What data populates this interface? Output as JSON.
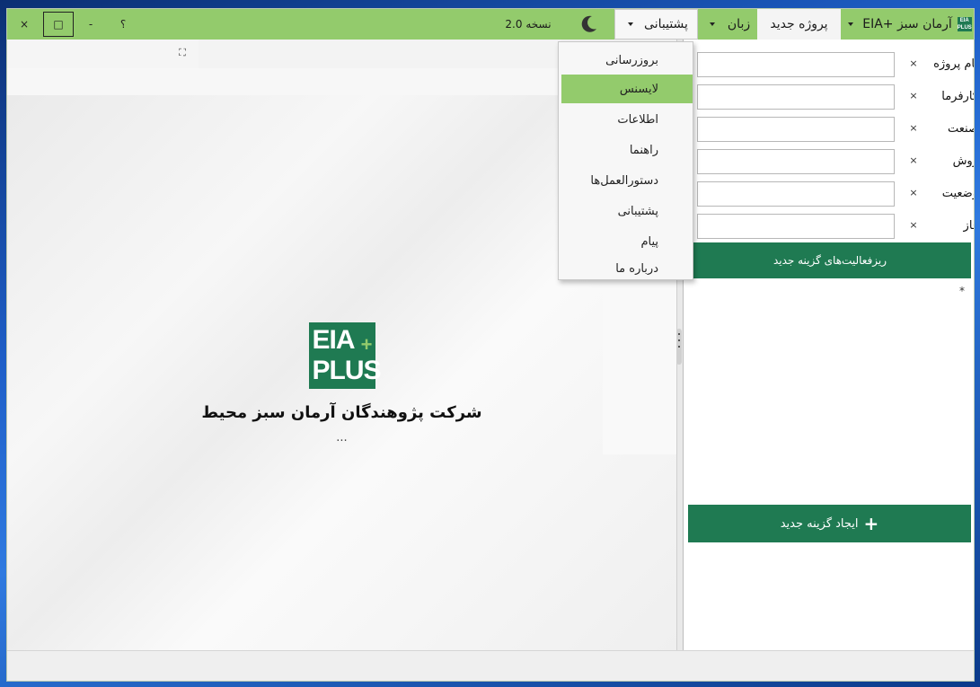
{
  "titlebar": {
    "brand_name": "EIA+ آرمان سبز",
    "brand_logo_text": "EIA PLUS",
    "new_project": "پروژه جدید",
    "language": "زبان",
    "support": "پشتیبانی",
    "version": "نسخه 2.0",
    "help": "؟",
    "minimize": "-",
    "maximize": "□",
    "close": "×"
  },
  "support_menu": {
    "items": [
      "بروزرسانی",
      "لایسنس",
      "اطلاعات",
      "راهنما",
      "دستورالعمل‌ها",
      "پشتیبانی",
      "پیام",
      "درباره ما"
    ],
    "active_index": 1
  },
  "splash": {
    "logo_line1": "EIA",
    "logo_line2": "PLUS",
    "logo_plus": "+",
    "company": "شرکت پژوهندگان آرمان سبز محیط",
    "loading": "..."
  },
  "form": {
    "fields": [
      {
        "label": "نام پروژه",
        "value": "",
        "clear": "×"
      },
      {
        "label": "کارفرما",
        "value": "",
        "clear": "×"
      },
      {
        "label": "صنعت",
        "value": "",
        "clear": "×"
      },
      {
        "label": "روش",
        "value": "",
        "clear": "×"
      },
      {
        "label": "وضعیت",
        "value": "",
        "clear": "×"
      },
      {
        "label": "فاز",
        "value": "",
        "clear": "×"
      }
    ],
    "subactivities_button": "ریزفعالیت‌های گزینه جدید",
    "required_marker": "*",
    "create_button": "ایجاد گزینه جدید",
    "create_icon": "+"
  },
  "colors": {
    "accent_green": "#93cb6c",
    "dark_green": "#1f7a52"
  }
}
